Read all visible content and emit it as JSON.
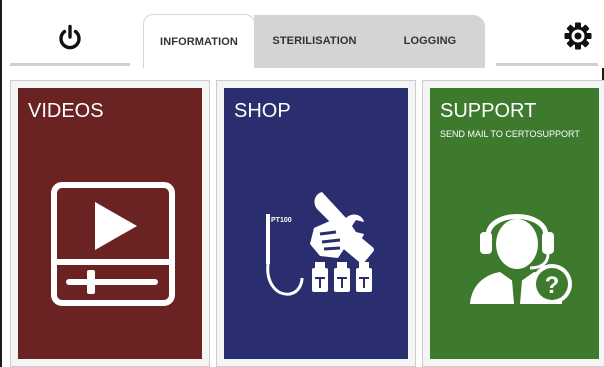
{
  "header": {
    "power_icon": "power-icon",
    "settings_icon": "gear-icon",
    "tabs": [
      {
        "label": "INFORMATION",
        "active": true
      },
      {
        "label": "STERILISATION",
        "active": false
      },
      {
        "label": "LOGGING",
        "active": false
      }
    ]
  },
  "tiles": [
    {
      "title": "VIDEOS",
      "color": "#6b2222",
      "icon": "video-player-icon"
    },
    {
      "title": "SHOP",
      "color": "#2a2e6e",
      "icon": "tools-sensor-icon",
      "icon_text": "PT100"
    },
    {
      "title": "SUPPORT",
      "subtitle": "SEND MAIL TO CERTOSUPPORT",
      "color": "#3d7a2e",
      "icon": "support-agent-icon"
    }
  ],
  "colors": {
    "tab_active": "#ffffff",
    "tab_inactive": "#d4d4d4",
    "icon_white": "#ffffff"
  }
}
